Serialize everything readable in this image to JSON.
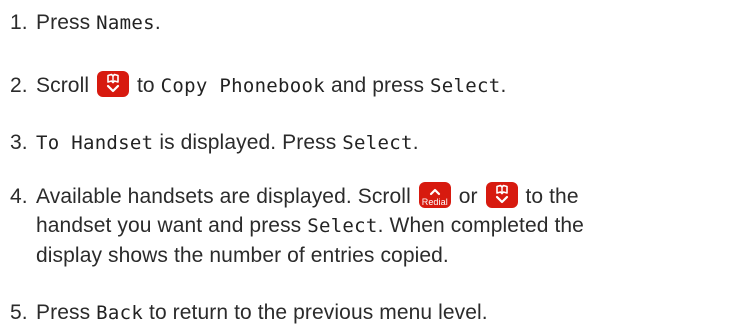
{
  "steps": [
    {
      "number": "1.",
      "text_1": "Press",
      "lcd_1": "Names",
      "text_2": "."
    },
    {
      "number": "2.",
      "text_1": "Scroll",
      "text_2": "to",
      "lcd_1": "Copy Phonebook",
      "text_3": "and press",
      "lcd_2": "Select",
      "text_4": "."
    },
    {
      "number": "3.",
      "lcd_1": "To Handset",
      "text_1": "is displayed. Press",
      "lcd_2": "Select",
      "text_2": "."
    },
    {
      "number": "4.",
      "text_1": "Available handsets are displayed. Scroll",
      "redial_key_label": "Redial",
      "text_2": "or",
      "text_3": "to the",
      "line2_text_1": "handset you want and press",
      "lcd_1": "Select",
      "line2_text_2": ". When completed the",
      "line3_text": "display shows the number of entries copied."
    },
    {
      "number": "5.",
      "text_1": "Press",
      "lcd_1": "Back",
      "text_2": "to return to the previous menu level."
    }
  ],
  "icons": {
    "scroll_down_key": "phonebook-down-key-icon",
    "scroll_up_key": "redial-up-key-icon"
  },
  "colors": {
    "key_red": "#d71a0f",
    "text": "#2b2b2b"
  }
}
